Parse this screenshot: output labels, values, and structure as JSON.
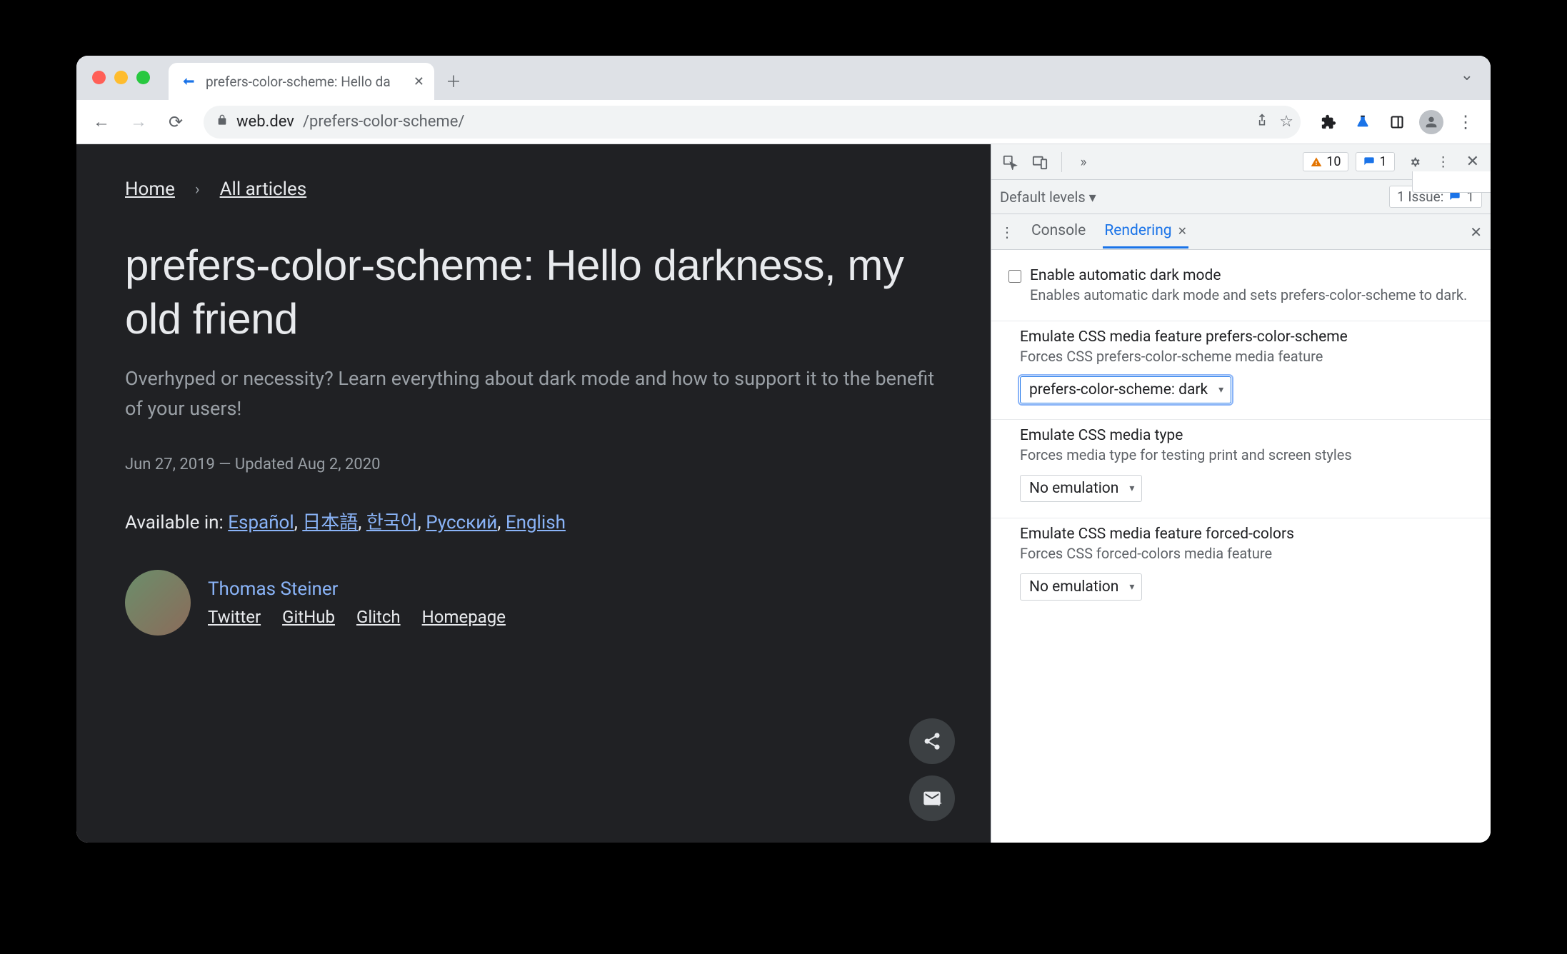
{
  "window": {
    "tab_title": "prefers-color-scheme: Hello da",
    "url_domain": "web.dev",
    "url_path": "/prefers-color-scheme/"
  },
  "page": {
    "breadcrumb": {
      "home": "Home",
      "all": "All articles"
    },
    "title": "prefers-color-scheme: Hello darkness, my old friend",
    "subtitle": "Overhyped or necessity? Learn everything about dark mode and how to support it to the benefit of your users!",
    "dates": "Jun 27, 2019 — Updated Aug 2, 2020",
    "langs_label": "Available in: ",
    "langs": {
      "es": "Español",
      "ja": "日本語",
      "ko": "한국어",
      "ru": "Русский",
      "en": "English"
    },
    "author": {
      "name": "Thomas Steiner",
      "links": {
        "twitter": "Twitter",
        "github": "GitHub",
        "glitch": "Glitch",
        "homepage": "Homepage"
      }
    }
  },
  "devtools": {
    "warnings": "10",
    "issues": "1",
    "default_levels": "Default levels ▾",
    "issue_label": "1 Issue:",
    "issue_count": "1",
    "tabs": {
      "console": "Console",
      "rendering": "Rendering"
    },
    "options": {
      "dark": {
        "title": "Enable automatic dark mode",
        "desc": "Enables automatic dark mode and sets prefers-color-scheme to dark."
      },
      "pcs": {
        "title": "Emulate CSS media feature prefers-color-scheme",
        "desc": "Forces CSS prefers-color-scheme media feature",
        "value": "prefers-color-scheme: dark"
      },
      "mediatype": {
        "title": "Emulate CSS media type",
        "desc": "Forces media type for testing print and screen styles",
        "value": "No emulation"
      },
      "forced": {
        "title": "Emulate CSS media feature forced-colors",
        "desc": "Forces CSS forced-colors media feature",
        "value": "No emulation"
      }
    }
  }
}
